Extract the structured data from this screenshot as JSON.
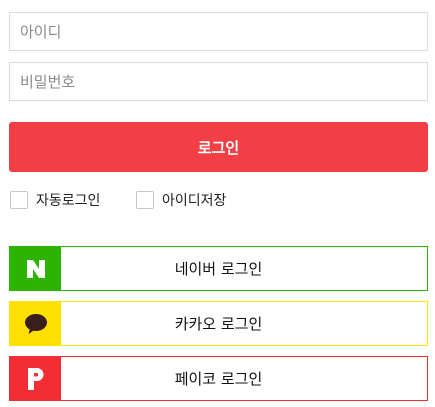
{
  "login_form": {
    "id_placeholder": "아이디",
    "pw_placeholder": "비밀번호",
    "login_label": "로그인",
    "auto_login_label": "자동로그인",
    "save_id_label": "아이디저장"
  },
  "social": [
    {
      "label": "네이버 로그인",
      "icon": "naver-n-icon",
      "color": "#2db400"
    },
    {
      "label": "카카오 로그인",
      "icon": "kakao-talk-bubble-icon",
      "color": "#ffe000"
    },
    {
      "label": "페이코 로그인",
      "icon": "payco-p-icon",
      "color": "#f22e35"
    }
  ],
  "colors": {
    "primary": "#f23f45",
    "field_border": "#dcdcdc"
  }
}
